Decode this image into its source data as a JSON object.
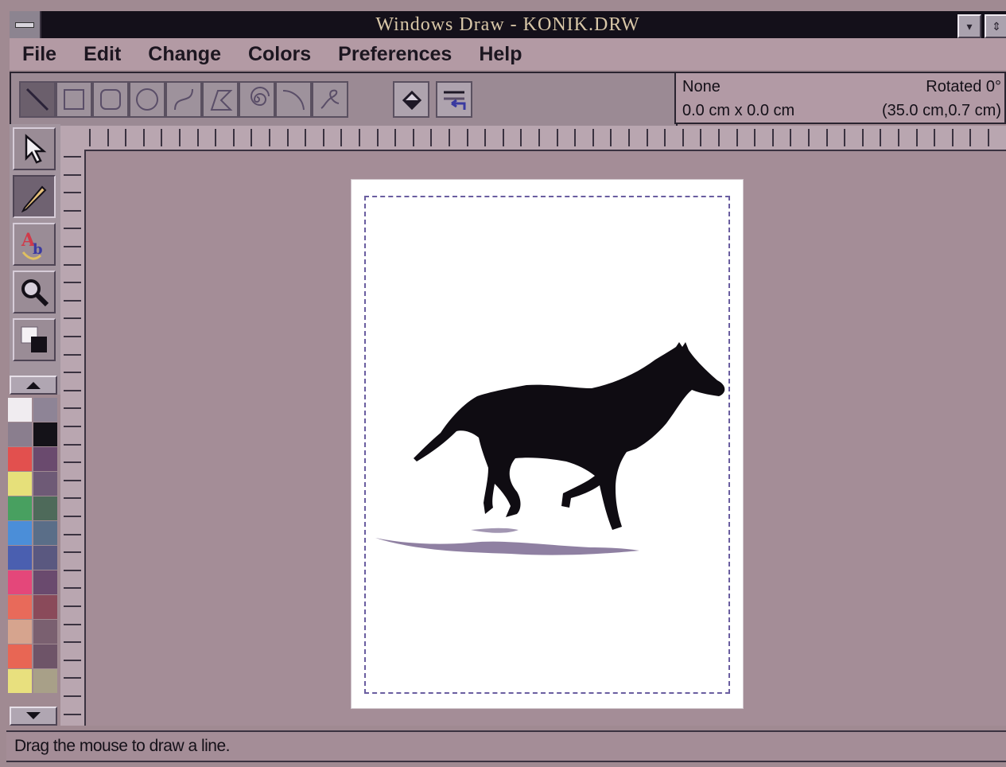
{
  "window": {
    "title": "Windows Draw - KONIK.DRW",
    "minimize_glyph": "▾",
    "maximize_glyph": "⇕"
  },
  "menu": {
    "items": [
      "File",
      "Edit",
      "Change",
      "Colors",
      "Preferences",
      "Help"
    ]
  },
  "toolbar": {
    "shape_tools": [
      "line-tool",
      "rectangle-tool",
      "rounded-rectangle-tool",
      "ellipse-tool",
      "curve-tool",
      "polygon-tool",
      "spiral-tool",
      "arc-tool",
      "freehand-tool"
    ],
    "action_tools": [
      "fill-tool",
      "line-style-tool"
    ],
    "active_tool": "line-tool"
  },
  "info": {
    "fill": "None",
    "size": "0.0 cm x 0.0 cm",
    "rotation": "Rotated 0°",
    "position": "(35.0 cm,0.7 cm)"
  },
  "toolbox": {
    "items": [
      "pointer-icon",
      "pencil-icon",
      "text-icon",
      "magnifier-icon",
      "color-swap-icon"
    ],
    "pressed": "pencil-icon"
  },
  "palette": {
    "colors_left": [
      "#f0ecf0",
      "#8a7e8e",
      "#e2504e",
      "#e6e07a",
      "#48a060",
      "#4b8ed8",
      "#4a5fb0",
      "#e4477a",
      "#e86a5a",
      "#d6a48e",
      "#e86654",
      "#e8e07e"
    ],
    "colors_right": [
      "#8e8496",
      "#141218",
      "#6a4a6e",
      "#6e5a76",
      "#4e6a5a",
      "#5a6e88",
      "#5a5880",
      "#6a4a6e",
      "#8a4a5a",
      "#7a6070",
      "#6e5468",
      "#a8a088"
    ]
  },
  "status": {
    "text": "Drag the mouse to draw a line."
  }
}
